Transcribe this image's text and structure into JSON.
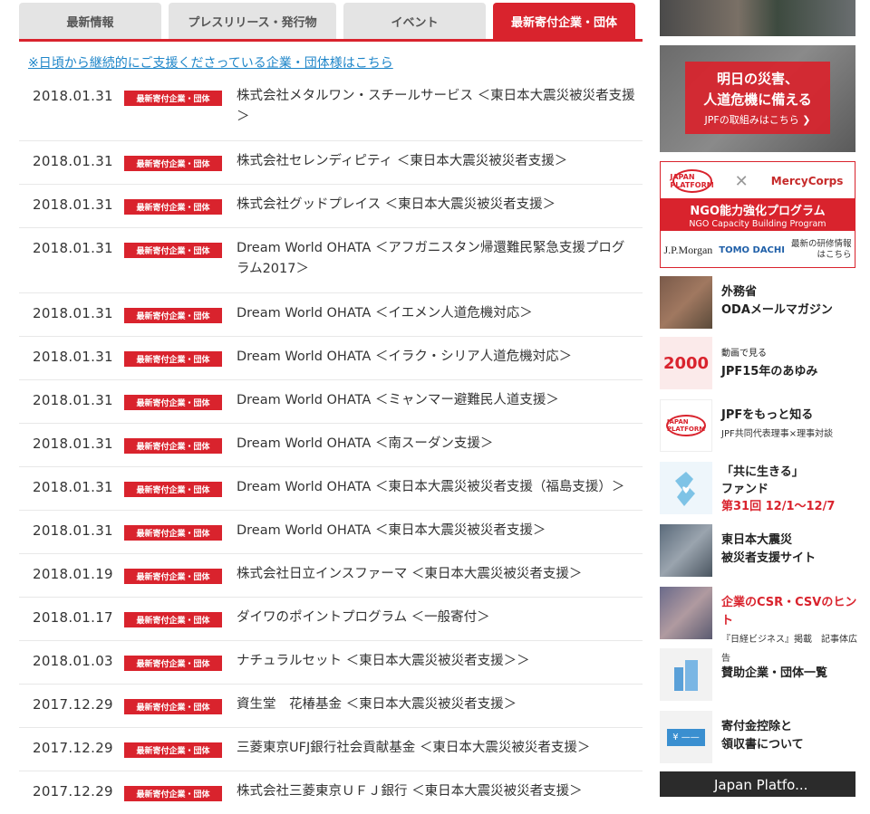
{
  "tabs": [
    {
      "label": "最新情報"
    },
    {
      "label": "プレスリリース・発行物"
    },
    {
      "label": "イベント"
    },
    {
      "label": "最新寄付企業・団体"
    }
  ],
  "notice": "※日頃から継続的にご支援くださっている企業・団体様はこちら",
  "badge_label": "最新寄付企業・団体",
  "rows": [
    {
      "date": "2018.01.31",
      "title": "株式会社メタルワン・スチールサービス ＜東日本大震災被災者支援＞"
    },
    {
      "date": "2018.01.31",
      "title": "株式会社セレンディピティ ＜東日本大震災被災者支援＞"
    },
    {
      "date": "2018.01.31",
      "title": "株式会社グッドプレイス ＜東日本大震災被災者支援＞"
    },
    {
      "date": "2018.01.31",
      "title": "Dream World OHATA ＜アフガニスタン帰還難民緊急支援プログラム2017＞"
    },
    {
      "date": "2018.01.31",
      "title": "Dream World OHATA ＜イエメン人道危機対応＞"
    },
    {
      "date": "2018.01.31",
      "title": "Dream World OHATA ＜イラク・シリア人道危機対応＞"
    },
    {
      "date": "2018.01.31",
      "title": "Dream World OHATA ＜ミャンマー避難民人道支援＞"
    },
    {
      "date": "2018.01.31",
      "title": "Dream World OHATA ＜南スーダン支援＞"
    },
    {
      "date": "2018.01.31",
      "title": "Dream World OHATA ＜東日本大震災被災者支援（福島支援）＞"
    },
    {
      "date": "2018.01.31",
      "title": "Dream World OHATA ＜東日本大震災被災者支援＞"
    },
    {
      "date": "2018.01.19",
      "title": "株式会社日立インスファーマ ＜東日本大震災被災者支援＞"
    },
    {
      "date": "2018.01.17",
      "title": "ダイワのポイントプログラム ＜一般寄付＞"
    },
    {
      "date": "2018.01.03",
      "title": "ナチュラルセット ＜東日本大震災被災者支援＞＞"
    },
    {
      "date": "2017.12.29",
      "title": "資生堂　花椿基金 ＜東日本大震災被災者支援＞"
    },
    {
      "date": "2017.12.29",
      "title": "三菱東京UFJ銀行社会貢献基金 ＜東日本大震災被災者支援＞"
    },
    {
      "date": "2017.12.29",
      "title": "株式会社三菱東京ＵＦＪ銀行 ＜東日本大震災被災者支援＞"
    }
  ],
  "sidebar": {
    "disaster_banner": {
      "line1": "明日の災害、",
      "line2": "人道危機に備える",
      "line3": "JPFの取組みはこちら ❯"
    },
    "ngo_banner": {
      "jpf_logo": "JAPAN PLATFORM",
      "mercy_logo": "MercyCorps",
      "title": "NGO能力強化プログラム",
      "subtitle": "NGO Capacity Building Program",
      "jpmorgan": "J.P.Morgan",
      "tomodachi": "TOMO DACHI",
      "training_line1": "最新の研修情報",
      "training_line2": "はこちら"
    },
    "items": [
      {
        "line1": "外務省",
        "line2": "ODAメールマガジン"
      },
      {
        "small": "動画で見る",
        "line2": "JPF15年のあゆみ"
      },
      {
        "line1": "JPFをもっと知る",
        "sub": "JPF共同代表理事×理事対談"
      },
      {
        "line1": "「共に生きる」",
        "line2": "ファンド",
        "line3": "第31回 12/1〜12/7"
      },
      {
        "line1": "東日本大震災",
        "line2": "被災者支援サイト"
      },
      {
        "line1": "企業のCSR・CSVのヒント",
        "sub": "『日経ビジネス』掲載　記事体広告"
      },
      {
        "line1": "賛助企業・団体一覧"
      },
      {
        "line1": "寄付金控除と",
        "line2": "領収書について"
      }
    ],
    "thumb_2000": "2000",
    "thumb_yen": "¥ ——",
    "bottom_banner": "Japan Platfo..."
  }
}
